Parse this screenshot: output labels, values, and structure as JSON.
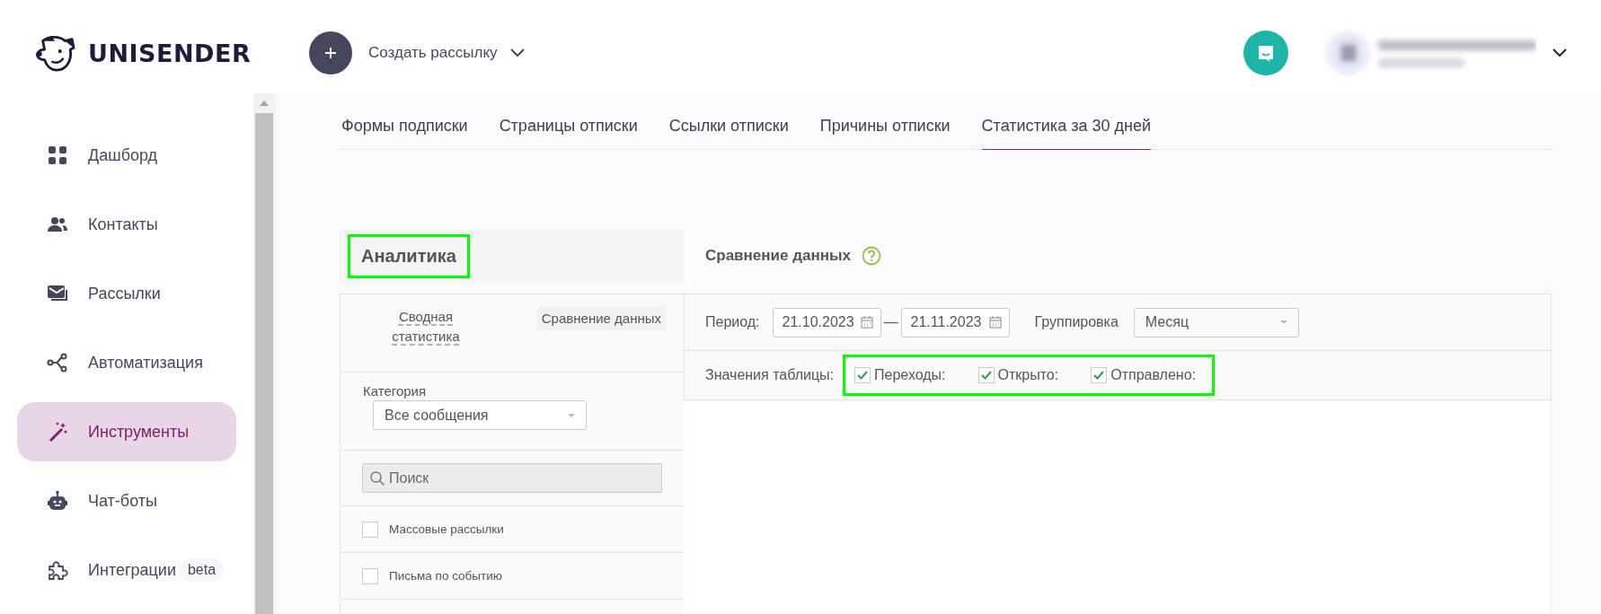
{
  "header": {
    "logo": "UNISENDER",
    "create_button": {
      "label": "Создать рассылку"
    }
  },
  "sidebar": {
    "items": [
      {
        "label": "Дашборд",
        "selected": false
      },
      {
        "label": "Контакты",
        "selected": false
      },
      {
        "label": "Рассылки",
        "selected": false
      },
      {
        "label": "Автоматизация",
        "selected": false
      },
      {
        "label": "Инструменты",
        "selected": true
      },
      {
        "label": "Чат-боты",
        "selected": false
      },
      {
        "label": "Интеграции",
        "badge": "beta",
        "selected": false
      }
    ]
  },
  "tabs": [
    {
      "label": "Формы подписки",
      "selected": false
    },
    {
      "label": "Страницы отписки",
      "selected": false
    },
    {
      "label": "Ссылки отписки",
      "selected": false
    },
    {
      "label": "Причины отписки",
      "selected": false
    },
    {
      "label": "Статистика за 30 дней",
      "selected": true
    }
  ],
  "analytics": {
    "title": "Аналитика",
    "highlighted": true,
    "modes": [
      {
        "label": "Сводная статистика",
        "selected": false
      },
      {
        "label": "Сравнение данных",
        "selected": true
      }
    ],
    "category": {
      "label": "Категория",
      "value": "Все сообщения"
    },
    "search": {
      "placeholder": "Поиск"
    },
    "filters": [
      {
        "label": "Массовые рассылки",
        "checked": false
      },
      {
        "label": "Письма по событию",
        "checked": false
      }
    ]
  },
  "comparison": {
    "title": "Сравнение данных",
    "period": {
      "label": "Период:",
      "from": "21.10.2023",
      "separator": "—",
      "to": "21.11.2023"
    },
    "grouping": {
      "label": "Группировка",
      "value": "Месяц"
    },
    "table_values": {
      "label": "Значения таблицы:",
      "highlighted": true,
      "options": [
        {
          "label": "Переходы:",
          "checked": true
        },
        {
          "label": "Открыто:",
          "checked": true
        },
        {
          "label": "Отправлено:",
          "checked": true
        }
      ]
    }
  }
}
